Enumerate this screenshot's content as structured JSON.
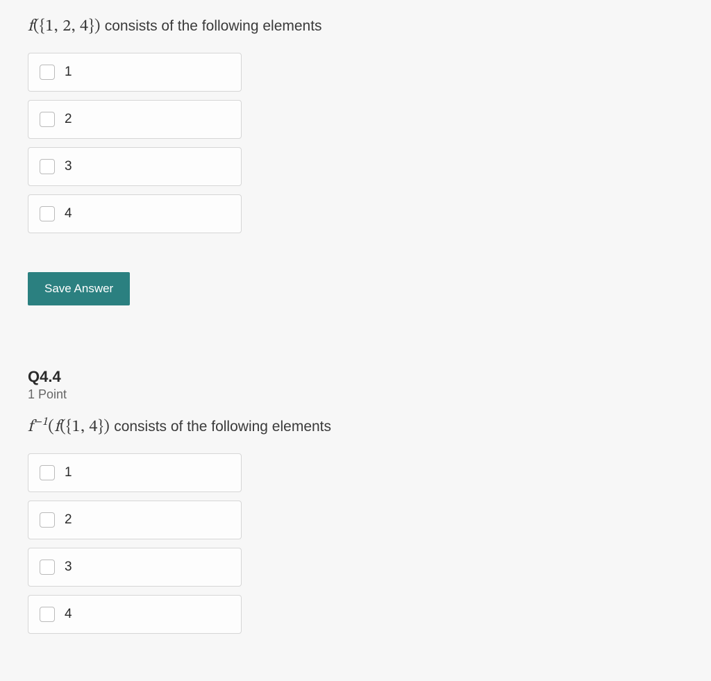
{
  "question1": {
    "prompt_math": "f({1, 2, 4})",
    "prompt_text": "consists of the following elements",
    "options": [
      "1",
      "2",
      "3",
      "4"
    ],
    "save_label": "Save Answer"
  },
  "question2": {
    "header": "Q4.4",
    "points": "1 Point",
    "prompt_math_prefix": "f",
    "prompt_math_exp": "−1",
    "prompt_math_rest": "(f({1, 4})",
    "prompt_text": "consists of the following elements",
    "options": [
      "1",
      "2",
      "3",
      "4"
    ]
  }
}
